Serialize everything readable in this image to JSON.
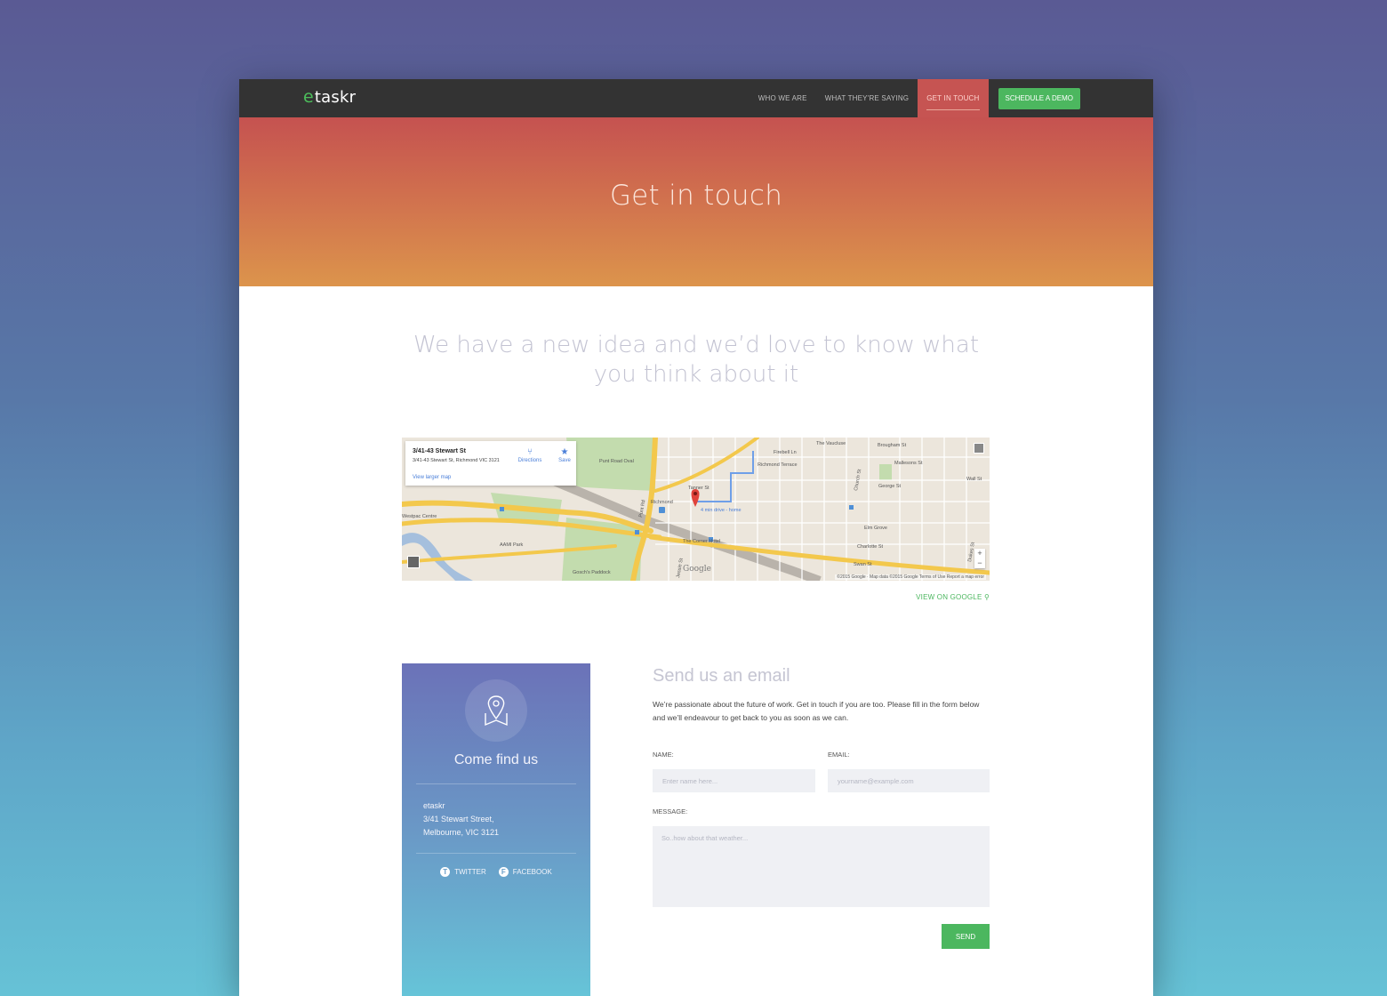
{
  "nav": {
    "logo_e": "e",
    "logo_text": "taskr",
    "items": [
      {
        "label": "WHO WE ARE"
      },
      {
        "label": "WHAT THEY'RE SAYING"
      },
      {
        "label": "GET IN TOUCH",
        "active": true
      }
    ],
    "demo_button": "SCHEDULE A DEMO"
  },
  "hero": {
    "title": "Get in touch"
  },
  "tagline": "We have a new idea and we’d love to know what you think about it",
  "map": {
    "card_title": "3/41-43 Stewart St",
    "card_address": "3/41-43 Stewart St, Richmond VIC 3121",
    "directions": "Directions",
    "save": "Save",
    "view_larger": "View larger map",
    "attribution": "©2015 Google · Map data ©2015 Google    Terms of Use    Report a map error",
    "google_label": "Google",
    "zoom_in": "+",
    "zoom_out": "−",
    "labels": [
      {
        "text": "Punt Road Oval"
      },
      {
        "text": "Richmond Terrace"
      },
      {
        "text": "Richmond"
      },
      {
        "text": "AAMI Park"
      },
      {
        "text": "Swan St"
      },
      {
        "text": "Charlotte St"
      },
      {
        "text": "Elm Grove"
      },
      {
        "text": "George St"
      },
      {
        "text": "The Vaucluse"
      },
      {
        "text": "Brougham St"
      },
      {
        "text": "Mallesons St"
      },
      {
        "text": "Wall St"
      },
      {
        "text": "Gosch's Paddock"
      },
      {
        "text": "Westpac Centre"
      },
      {
        "text": "The Corner Hotel"
      },
      {
        "text": "4 min drive - home"
      },
      {
        "text": "Tanner St"
      },
      {
        "text": "Firebell Ln"
      },
      {
        "text": "Punt Rd"
      },
      {
        "text": "Church St"
      },
      {
        "text": "Jessie St"
      },
      {
        "text": "Dukes St"
      }
    ],
    "colors": {
      "road": "#f3c84c",
      "park": "#c3dcae",
      "water": "#a5bfdd",
      "land": "#ece6dc"
    }
  },
  "view_on_google": "VIEW ON GOOGLE",
  "find_us": {
    "title": "Come find us",
    "company": "etaskr",
    "street": "3/41 Stewart Street,",
    "city": "Melbourne, VIC 3121",
    "twitter": "TWITTER",
    "facebook": "FACEBOOK",
    "icon": "map-pin-icon"
  },
  "email_form": {
    "title": "Send us an email",
    "description": "We’re passionate about the future of work. Get in touch if you are too. Please fill in the form below and we’ll endeavour to get back to you as soon as we can.",
    "name_label": "NAME:",
    "name_placeholder": "Enter name here...",
    "email_label": "EMAIL:",
    "email_placeholder": "yourname@example.com",
    "message_label": "MESSAGE:",
    "message_placeholder": "So..how about that weather...",
    "send_label": "SEND"
  },
  "colors": {
    "accent_green": "#4cb75f",
    "nav_bg": "#333333",
    "nav_active": "#c65452",
    "hero_top": "#c55250",
    "hero_bottom": "#dc944c"
  }
}
